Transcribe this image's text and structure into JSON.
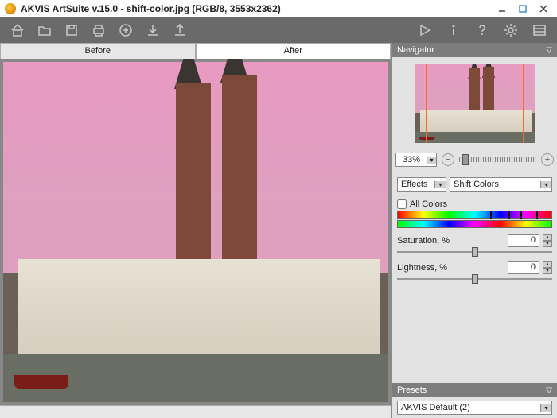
{
  "title": "AKVIS ArtSuite v.15.0 - shift-color.jpg (RGB/8, 3553x2362)",
  "tabs": {
    "before": "Before",
    "after": "After"
  },
  "navigator": {
    "title": "Navigator",
    "zoom": "33%"
  },
  "effects": {
    "label": "Effects",
    "mode": "Shift Colors"
  },
  "params": {
    "all_colors": "All Colors",
    "saturation_label": "Saturation, %",
    "saturation_value": "0",
    "lightness_label": "Lightness, %",
    "lightness_value": "0"
  },
  "presets": {
    "title": "Presets",
    "selected": "AKVIS Default (2)"
  }
}
